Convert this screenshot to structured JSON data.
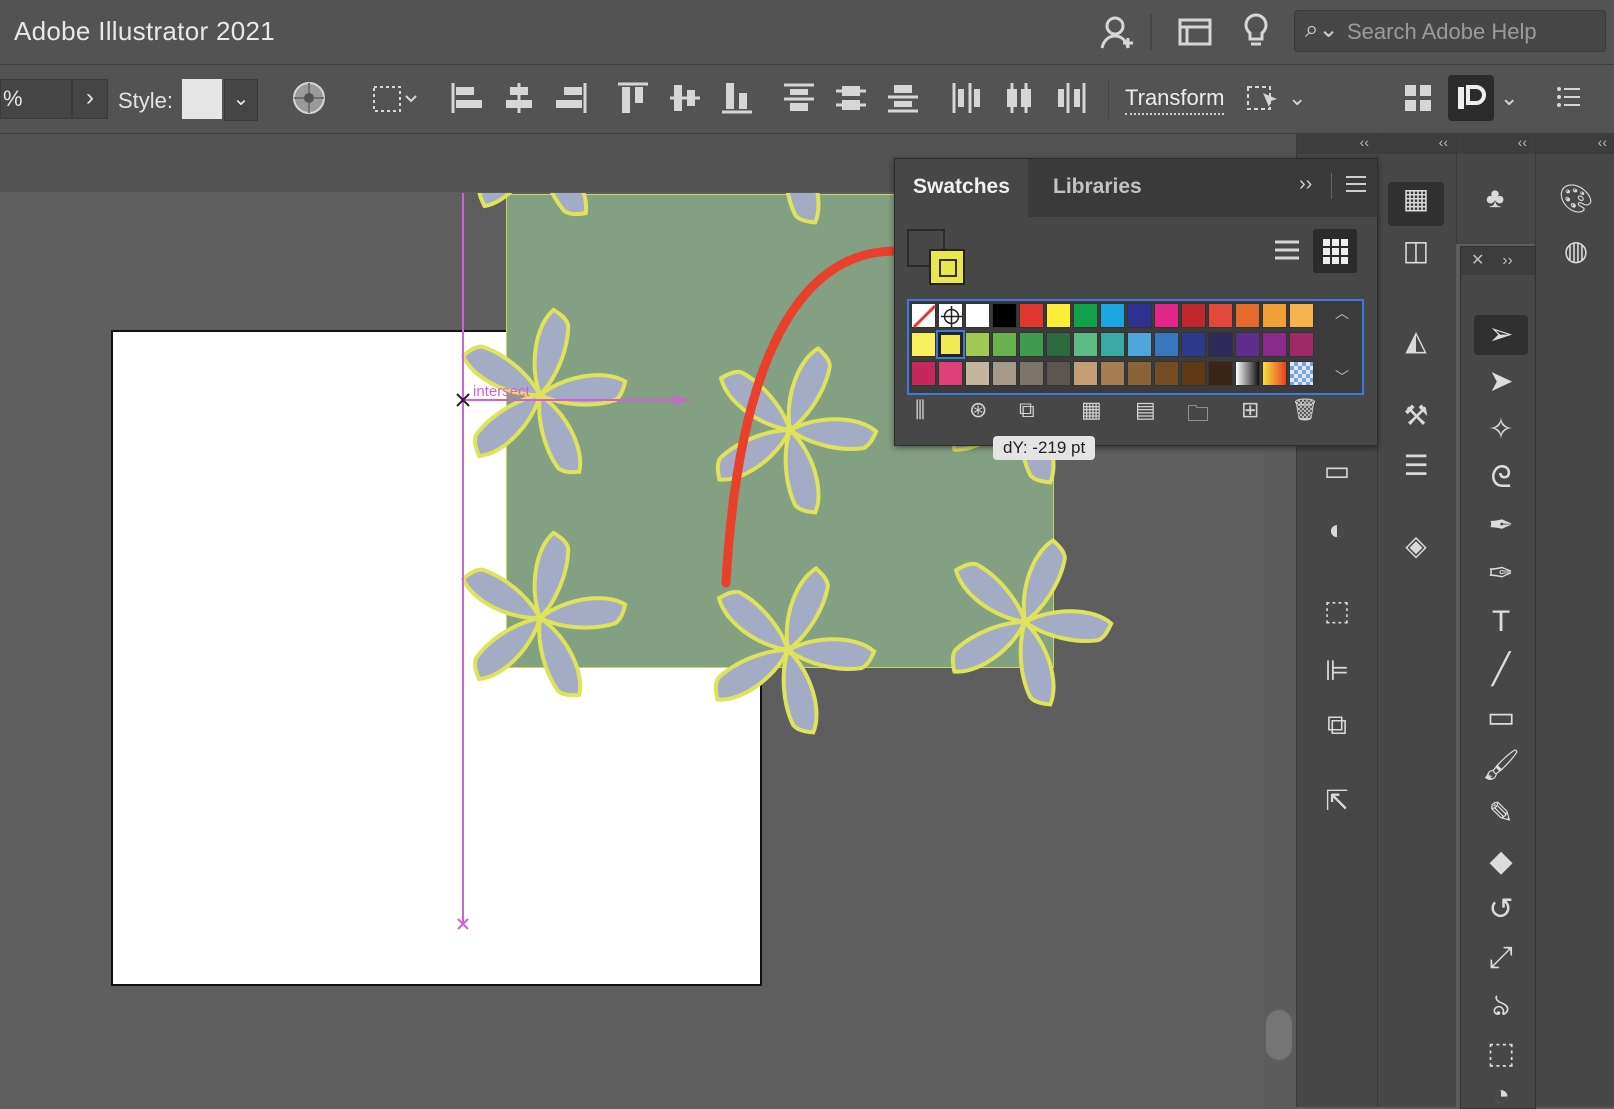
{
  "app": {
    "title": "Adobe Illustrator 2021"
  },
  "header": {
    "search_placeholder": "Search Adobe Help"
  },
  "controlbar": {
    "opacity_value": "%",
    "style_label": "Style:",
    "transform_label": "Transform"
  },
  "canvas": {
    "smart_guide_label": "intersect",
    "tooltip": "dY: -219 pt"
  },
  "swatches_panel": {
    "tabs": [
      "Swatches",
      "Libraries"
    ],
    "active_tab": "Swatches",
    "rows": [
      [
        "none",
        "registration",
        "#ffffff",
        "#000000",
        "#e23631",
        "#fcee36",
        "#12a14b",
        "#1ba5e1",
        "#2e3192",
        "#e2268a",
        "#c1272d",
        "#e2483a",
        "#e76a2a",
        "#f0a035",
        "#f7b44e"
      ],
      [
        "#f9f05c",
        "selected-yellow",
        "#a1c855",
        "#6ab24f",
        "#3f9b4d",
        "#2d6a3e",
        "#5fba84",
        "#3ba9a4",
        "#4ea6dc",
        "#3876bd",
        "#2c3a8e",
        "#2d2a5c",
        "#5e2e8e",
        "#8a2a8a",
        "#9e2a66"
      ],
      [
        "#c5285c",
        "#e0407a",
        "#c4b59c",
        "#a5998c",
        "#7e756a",
        "#5c5550",
        "#c39b74",
        "#a67c52",
        "#8c6239",
        "#754c24",
        "#603813",
        "#3c2415",
        "gradient-gray",
        "gradient-orange",
        "pattern-check"
      ]
    ]
  },
  "colors": {
    "accent_selection": "#3f7ad9",
    "pattern_fill": "#84a082",
    "flower_fill": "#a3acc4",
    "flower_stroke": "#dfe35a",
    "smart_guide": "#d55fd8",
    "annotation_arrow": "#e8402a"
  },
  "tools": [
    "selection-tool",
    "direct-selection-tool",
    "magic-wand-tool",
    "lasso-tool",
    "pen-tool",
    "curvature-tool",
    "type-tool",
    "line-segment-tool",
    "rectangle-tool",
    "paintbrush-tool",
    "shaper-tool",
    "eraser-tool",
    "rotate-tool",
    "scale-tool",
    "warp-tool",
    "free-transform-tool",
    "shape-builder-tool"
  ]
}
